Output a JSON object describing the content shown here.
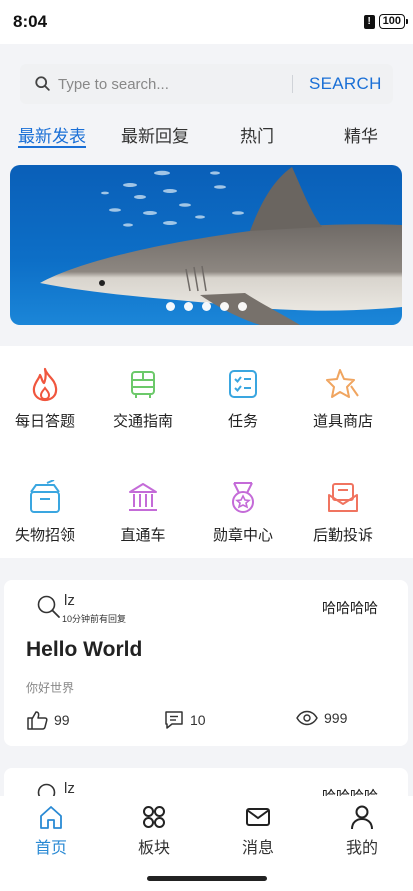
{
  "status": {
    "time": "8:04",
    "battery": "100"
  },
  "search": {
    "placeholder": "Type to search...",
    "button_label": "SEARCH"
  },
  "tabs": [
    {
      "label": "最新发表",
      "active": true
    },
    {
      "label": "最新回复"
    },
    {
      "label": "热门"
    },
    {
      "label": "精华"
    }
  ],
  "banner": {
    "slides": 5,
    "active_slide": 1
  },
  "grid": [
    {
      "label": "每日答题",
      "icon": "flame-icon"
    },
    {
      "label": "交通指南",
      "icon": "bus-icon"
    },
    {
      "label": "任务",
      "icon": "checklist-icon"
    },
    {
      "label": "道具商店",
      "icon": "star-icon"
    },
    {
      "label": "失物招领",
      "icon": "box-icon"
    },
    {
      "label": "直通车",
      "icon": "bank-icon"
    },
    {
      "label": "勋章中心",
      "icon": "medal-icon"
    },
    {
      "label": "后勤投诉",
      "icon": "mail-icon"
    }
  ],
  "posts": [
    {
      "user": "lz",
      "subtitle": "10分钟前有回复",
      "tag": "哈哈哈哈",
      "title": "Hello World",
      "desc": "你好世界",
      "likes": "99",
      "comments": "10",
      "views": "999"
    },
    {
      "user": "lz",
      "tag": "哈哈哈哈"
    }
  ],
  "nav": [
    {
      "label": "首页",
      "icon": "home-icon",
      "active": true
    },
    {
      "label": "板块",
      "icon": "grid-icon"
    },
    {
      "label": "消息",
      "icon": "envelope-icon"
    },
    {
      "label": "我的",
      "icon": "user-icon"
    }
  ],
  "colors": {
    "accent": "#1a6fd6",
    "nav_active": "#2a8ad4",
    "background": "#f3f4f7"
  }
}
